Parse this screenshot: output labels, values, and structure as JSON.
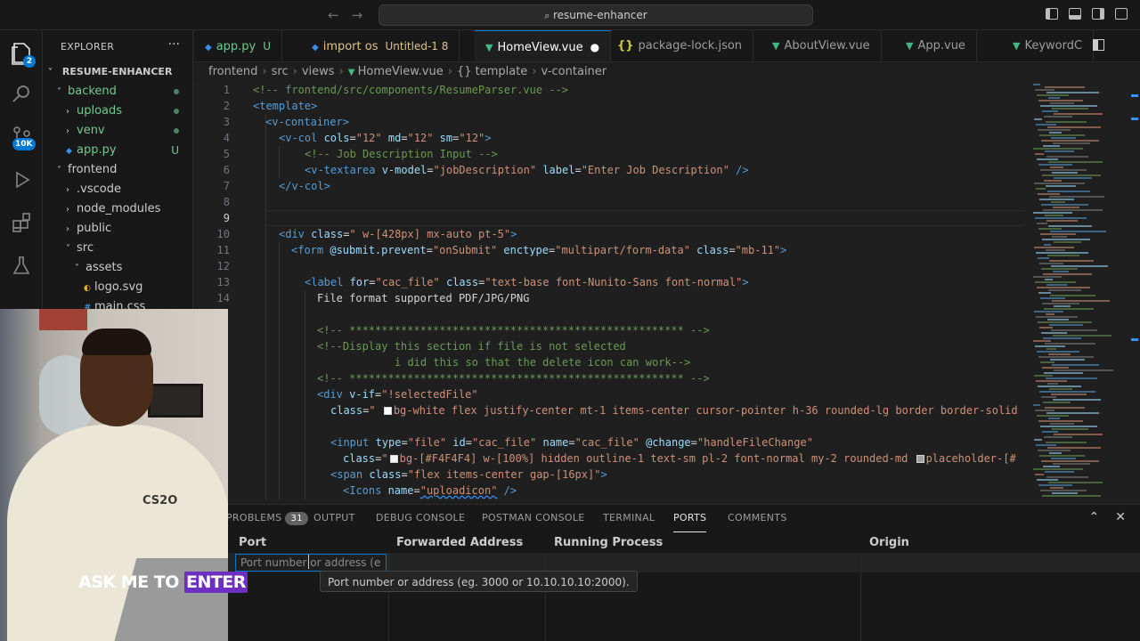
{
  "titlebar": {
    "search_text": "resume-enhancer"
  },
  "activity_bar": {
    "explorer_badge": "2",
    "source_control_badge": "10K"
  },
  "sidebar": {
    "title": "EXPLORER",
    "more": "···",
    "root": "RESUME-ENHANCER",
    "items": [
      {
        "label": "backend",
        "indent": 1,
        "chev": "˅",
        "status": "dot"
      },
      {
        "label": "uploads",
        "indent": 2,
        "chev": "›",
        "status": "dot"
      },
      {
        "label": "venv",
        "indent": 2,
        "chev": "›",
        "status": "dot"
      },
      {
        "label": "app.py",
        "indent": 2,
        "chev": "",
        "status": "U"
      },
      {
        "label": "frontend",
        "indent": 1,
        "chev": "˅",
        "status": ""
      },
      {
        "label": ".vscode",
        "indent": 2,
        "chev": "›",
        "status": ""
      },
      {
        "label": "node_modules",
        "indent": 2,
        "chev": "›",
        "status": ""
      },
      {
        "label": "public",
        "indent": 2,
        "chev": "›",
        "status": ""
      },
      {
        "label": "src",
        "indent": 2,
        "chev": "˅",
        "status": ""
      },
      {
        "label": "assets",
        "indent": 3,
        "chev": "˅",
        "status": ""
      },
      {
        "label": "logo.svg",
        "indent": 4,
        "chev": "",
        "status": ""
      },
      {
        "label": "main.css",
        "indent": 4,
        "chev": "",
        "status": ""
      }
    ]
  },
  "tabs": [
    {
      "label": "app.py",
      "suffix": "U",
      "icon": "python-icon"
    },
    {
      "label": "import os",
      "suffix": "Untitled-1 8",
      "icon": "python-icon"
    },
    {
      "label": "HomeView.vue",
      "suffix": "●",
      "icon": "vue-icon",
      "active": true
    },
    {
      "label": "package-lock.json",
      "suffix": "",
      "icon": "json-icon"
    },
    {
      "label": "AboutView.vue",
      "suffix": "",
      "icon": "vue-icon"
    },
    {
      "label": "App.vue",
      "suffix": "",
      "icon": "vue-icon"
    },
    {
      "label": "KeywordC",
      "suffix": "",
      "icon": "vue-icon"
    }
  ],
  "breadcrumb": [
    "frontend",
    "src",
    "views",
    "HomeView.vue",
    "{} template",
    "v-container"
  ],
  "line_numbers": [
    "1",
    "2",
    "3",
    "4",
    "5",
    "6",
    "7",
    "8",
    "9",
    "10",
    "11",
    "12",
    "13",
    "14"
  ],
  "code": {
    "l1": "<!-- frontend/src/components/ResumeParser.vue -->",
    "l2_tag": "<template>",
    "l3_tag": "<v-container>",
    "l4": {
      "open": "<v-col",
      "a1": " cols",
      "v1": "\"12\"",
      "a2": " md",
      "v2": "\"12\"",
      "a3": " sm",
      "v3": "\"12\"",
      "close": ">"
    },
    "l5": "<!-- Job Description Input -->",
    "l6": {
      "open": "<v-textarea",
      "a1": " v-model",
      "v1": "\"jobDescription\"",
      "a2": " label",
      "v2": "\"Enter Job Description\"",
      "close": " />"
    },
    "l7_tag": "</v-col>",
    "l10": {
      "open": "<div",
      "a1": " class",
      "v1": "\" w-[428px] mx-auto pt-5\"",
      "close": ">"
    },
    "l11": {
      "open": "<form",
      "a1": " @submit.prevent",
      "v1": "\"onSubmit\"",
      "a2": " enctype",
      "v2": "\"multipart/form-data\"",
      "a3": " class",
      "v3": "\"mb-11\"",
      "close": ">"
    },
    "l13": {
      "open": "<label",
      "a1": " for",
      "v1": "\"cac_file\"",
      "a2": " class",
      "v2": "\"text-base font-Nunito-Sans font-normal\"",
      "close": ">"
    },
    "l14": "File format supported PDF/JPG/PNG",
    "l16": "<!-- **************************************************** -->",
    "l17": "<!--Display this section if file is not selected",
    "l18": "i did this so that the delete icon can work-->",
    "l19": "<!-- **************************************************** -->",
    "l20": {
      "open": "<div",
      "a1": " v-if",
      "v1": "\"!selectedFile\""
    },
    "l21": {
      "a1": "class",
      "v1a": "\"",
      "v1b": "bg-white flex justify-center mt-1 items-center cursor-pointer h-36 rounded-lg border border-solid"
    },
    "l23": {
      "open": "<input",
      "a1": " type",
      "v1": "\"file\"",
      "a2": " id",
      "v2": "\"cac_file\"",
      "a3": " name",
      "v3": "\"cac_file\"",
      "a4": " @change",
      "v4": "\"handleFileChange\""
    },
    "l24": {
      "a1": "class",
      "v1a": "\"",
      "v1b": "bg-[#F4F4F4] w-[100%] hidden outline-1 text-sm pl-2 font-normal my-2 rounded-md ",
      "v1c": "placeholder-[#"
    },
    "l25": {
      "open": "<span",
      "a1": " class",
      "v1": "\"flex items-center gap-[16px]\"",
      "close": ">"
    },
    "l26": {
      "open": "<Icons",
      "a1": " name",
      "v1": "\"uploadicon\"",
      "close": " />"
    }
  },
  "panel": {
    "tabs": [
      {
        "label": "PROBLEMS",
        "count": "31"
      },
      {
        "label": "OUTPUT"
      },
      {
        "label": "DEBUG CONSOLE"
      },
      {
        "label": "POSTMAN CONSOLE"
      },
      {
        "label": "TERMINAL"
      },
      {
        "label": "PORTS",
        "active": true
      },
      {
        "label": "COMMENTS"
      }
    ],
    "columns": [
      "Port",
      "Forwarded Address",
      "Running Process",
      "Origin"
    ],
    "port_input_value": "Port number or address (e",
    "tooltip": "Port number or address (eg. 3000 or 10.10.10.10:2000)."
  },
  "webcam": {
    "hoodie_logo": "CS2O",
    "caption_plain": "ASK ME TO ",
    "caption_highlight": "ENTER"
  },
  "colors": {
    "accent": "#0078d4",
    "caption_highlight": "#6d2fbf",
    "vue_green": "#42b883",
    "python_blue": "#3b8eea"
  }
}
